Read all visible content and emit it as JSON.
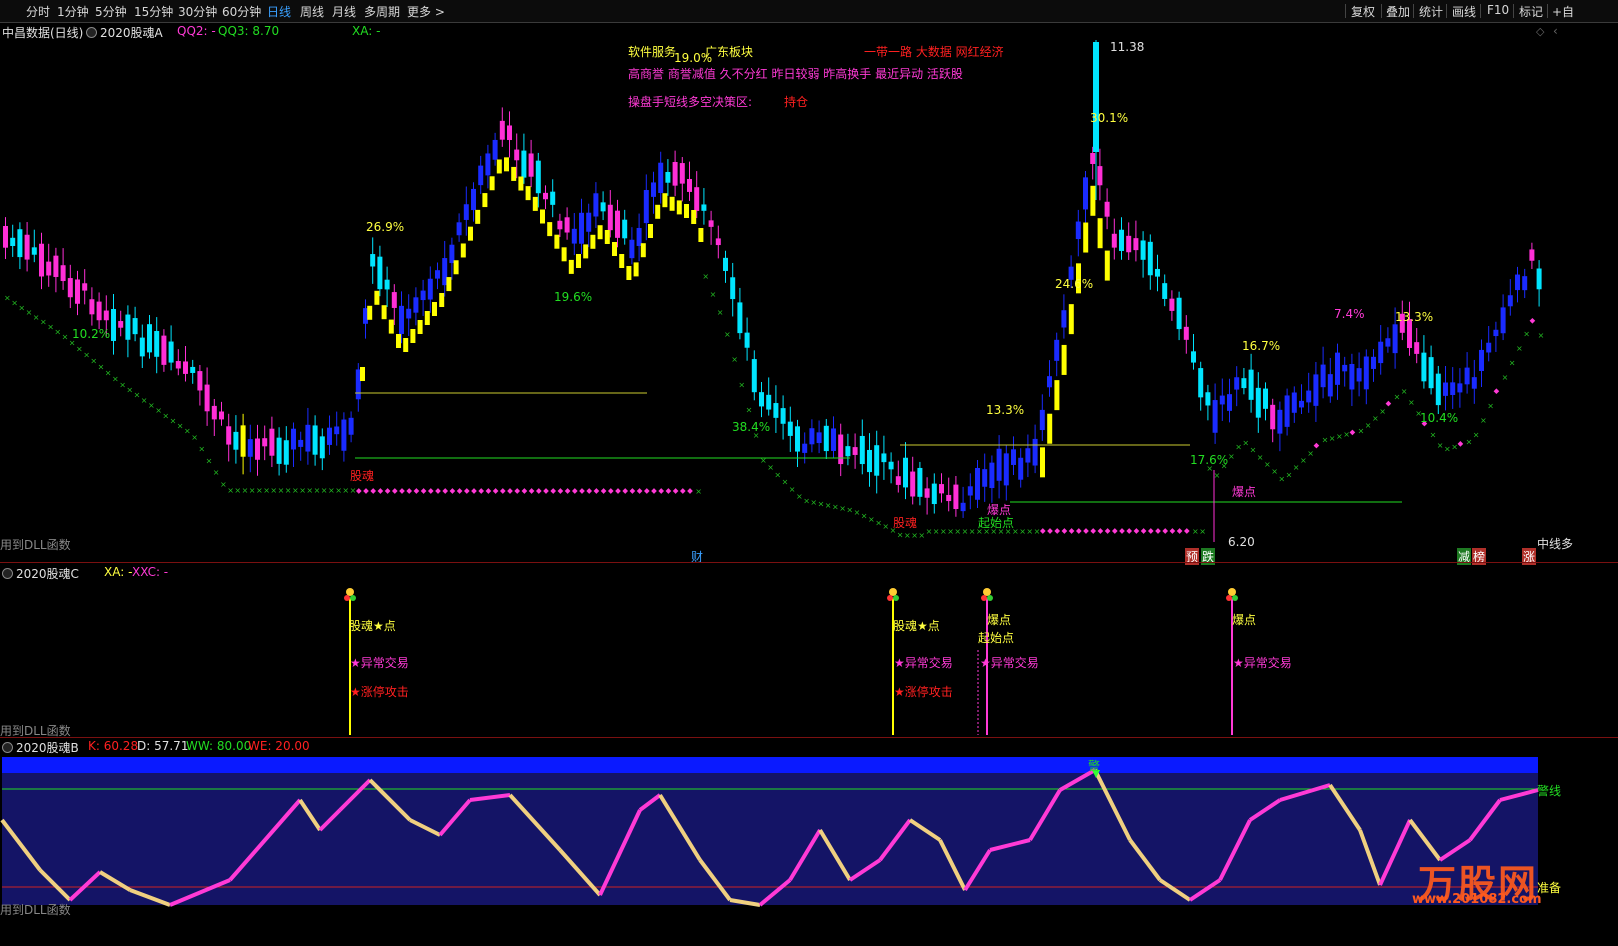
{
  "toolbar": {
    "periods": [
      "分时",
      "1分钟",
      "5分钟",
      "15分钟",
      "30分钟",
      "60分钟",
      "日线",
      "周线",
      "月线",
      "多周期",
      "更多 >"
    ],
    "active_period": "日线",
    "actions": [
      "复权",
      "叠加",
      "统计",
      "画线",
      "F10",
      "标记",
      "+自"
    ]
  },
  "main_panel": {
    "stock_title": "中昌数据(日线)",
    "indicator": "2020股魂A",
    "qq2": "QQ2: -",
    "qq3": "QQ3: 8.70",
    "xa": "XA: -",
    "sector1": "软件服务",
    "sector2": "广东板块",
    "concepts_red": "一带一路 大数据 网红经济",
    "tags": "高商誉 商誉减值 久不分红 昨日较弱 昨高换手 最近异动 活跃股",
    "strategy_label": "操盘手短线多空决策区:",
    "strategy_value": "持仓",
    "high_price": "11.38",
    "low_price": "6.20",
    "pcts": [
      "26.9%",
      "10.2%",
      "19.6%",
      "19.0%",
      "38.4%",
      "30.1%",
      "24.6%",
      "13.3%",
      "17.6%",
      "16.7%",
      "7.4%",
      "13.3%",
      "10.4%"
    ],
    "marks": [
      "股魂",
      "股魂",
      "爆点",
      "起始点",
      "爆点"
    ],
    "dll_text": "用到DLL函数",
    "zhongxian": "中线多",
    "bottom_marks": [
      "财",
      "预",
      "跌",
      "减",
      "榜",
      "涨"
    ]
  },
  "panel_c": {
    "indicator": "2020股魂C",
    "xa": "XA: -",
    "xxc": "XXC: -",
    "signal1": "股魂★点",
    "signal2": "★异常交易",
    "signal3": "★涨停攻击",
    "signal4": "爆点",
    "signal5": "起始点",
    "signal6": "★异常交易",
    "dll_text": "用到DLL函数"
  },
  "panel_b": {
    "indicator": "2020股魂B",
    "k": "K: 60.28",
    "d": "D: 57.71",
    "ww": "WW: 80.00",
    "we": "WE: 20.00",
    "warn": "警",
    "warn_line": "警线",
    "ready": "准备",
    "dll_text": "用到DLL函数",
    "watermark": "万股网",
    "watermark_url": "www.201082.com"
  },
  "colors": {
    "up_cyan": "#00e5ff",
    "up_magenta": "#ff2fd6",
    "down_blue": "#1a2bff",
    "yellow": "#ffff00",
    "green_line": "#22dd22"
  }
}
